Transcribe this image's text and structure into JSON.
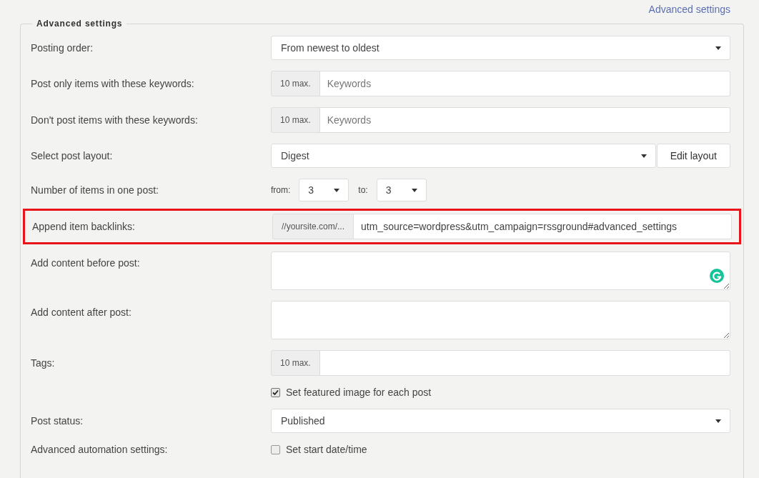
{
  "top_link": "Advanced settings",
  "panel": {
    "title": "Advanced settings",
    "rows": [
      {
        "kind": "select",
        "label": "Posting order:",
        "value": "From newest to oldest"
      },
      {
        "kind": "addon-input",
        "label": "Post only items with these keywords:",
        "addon": "10 max.",
        "placeholder": "Keywords"
      },
      {
        "kind": "addon-input",
        "label": "Don't post items with these keywords:",
        "addon": "10 max.",
        "placeholder": "Keywords"
      },
      {
        "kind": "select-button",
        "label": "Select post layout:",
        "value": "Digest",
        "button": "Edit layout"
      },
      {
        "kind": "range",
        "label": "Number of items in one post:",
        "from_label": "from:",
        "from_value": "3",
        "to_label": "to:",
        "to_value": "3"
      },
      {
        "kind": "addon-input",
        "label": "Append item backlinks:",
        "addon": "//yoursite.com/...",
        "value": "utm_source=wordpress&utm_campaign=rssground#advanced_settings",
        "highlighted": true
      },
      {
        "kind": "textarea",
        "label": "Add content before post:",
        "assistant_badge": true
      },
      {
        "kind": "textarea",
        "label": "Add content after post:",
        "assistant_badge": false
      },
      {
        "kind": "addon-input",
        "label": "Tags:",
        "addon": "10 max."
      },
      {
        "kind": "checkbox",
        "option": "Set featured image for each post",
        "checked": true
      },
      {
        "kind": "select",
        "label": "Post status:",
        "value": "Published"
      },
      {
        "kind": "checkbox",
        "label": "Advanced automation settings:",
        "option": "Set start date/time",
        "checked": false
      }
    ]
  }
}
